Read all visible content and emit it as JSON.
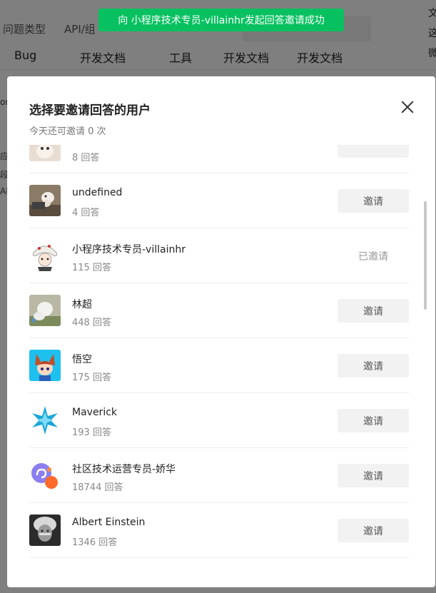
{
  "background": {
    "top_tabs": [
      "问题类型",
      "API/组"
    ],
    "nav": [
      "Bug",
      "开发文档",
      "工具",
      "开发文档",
      "开发文档"
    ],
    "right_fragments": [
      "文",
      "这",
      "微"
    ],
    "left_fragments": [
      "or",
      "应月",
      "段记",
      "AP"
    ]
  },
  "toast": {
    "text": "向 小程序技术专员-villainhr发起回答邀请成功"
  },
  "dialog": {
    "title": "选择要邀请回答的用户",
    "subtitle": "今天还可邀请 0 次",
    "users": [
      {
        "name": "",
        "count": "8 回答",
        "action": "invite",
        "action_label": "",
        "avatar": "cat-avatar"
      },
      {
        "name": "undefined",
        "count": "4 回答",
        "action": "invite",
        "action_label": "邀请",
        "avatar": "hamster-avatar"
      },
      {
        "name": "小程序技术专员-villainhr",
        "count": "115 回答",
        "action": "invited",
        "action_label": "已邀请",
        "avatar": "cartoon-avatar"
      },
      {
        "name": "林超",
        "count": "448 回答",
        "action": "invite",
        "action_label": "邀请",
        "avatar": "plush-avatar"
      },
      {
        "name": "悟空",
        "count": "175 回答",
        "action": "invite",
        "action_label": "邀请",
        "avatar": "anime-avatar"
      },
      {
        "name": "Maverick",
        "count": "193 回答",
        "action": "invite",
        "action_label": "邀请",
        "avatar": "star-avatar"
      },
      {
        "name": "社区技术运营专员-娇华",
        "count": "18744 回答",
        "action": "invite",
        "action_label": "邀请",
        "avatar": "miniprogram-logo-avatar"
      },
      {
        "name": "Albert Einstein",
        "count": "1346 回答",
        "action": "invite",
        "action_label": "邀请",
        "avatar": "portrait-avatar"
      }
    ]
  },
  "colors": {
    "toast": "#07c160",
    "button_bg": "#f2f2f2"
  }
}
